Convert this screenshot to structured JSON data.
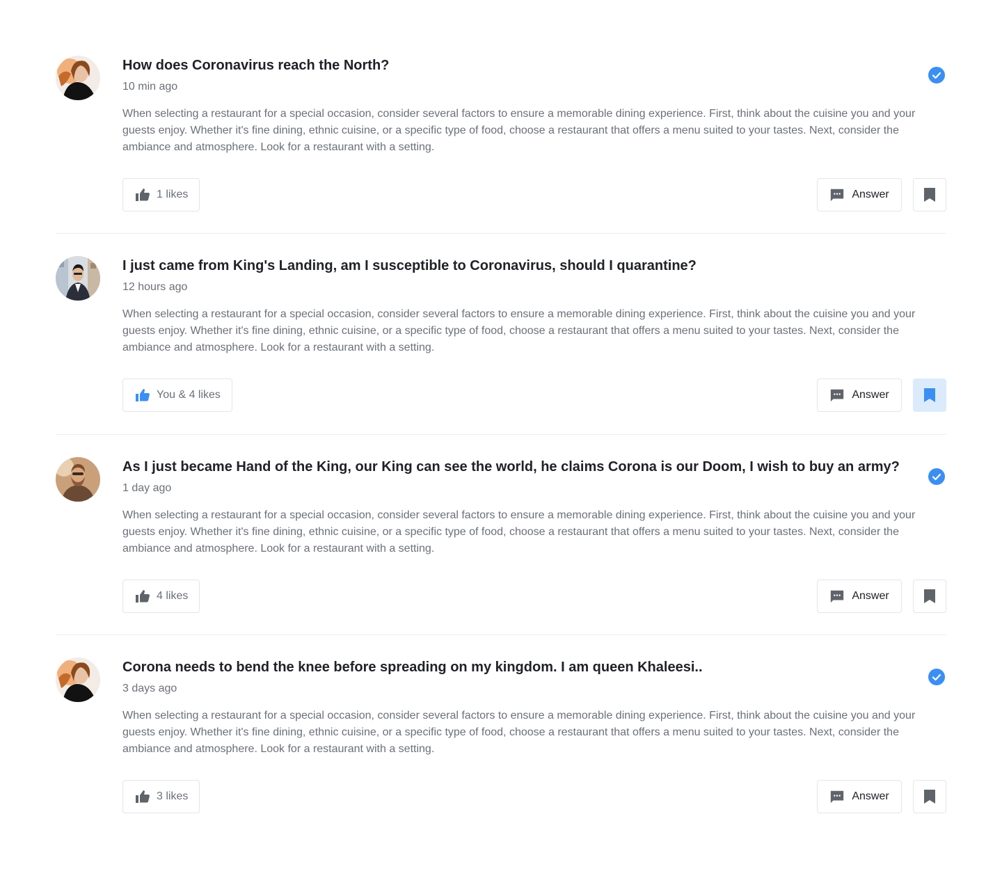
{
  "colors": {
    "accent": "#3b8ff3",
    "icon_gray": "#5f636a",
    "bookmark_active_bg": "#dcebfc"
  },
  "posts": [
    {
      "title": "How does Coronavirus reach the North?",
      "time": "10 min ago",
      "body": "When selecting a restaurant for a special occasion, consider several factors to ensure a memorable dining experience. First, think about the cuisine you and your guests enjoy. Whether it's fine dining, ethnic cuisine, or a specific type of food, choose a restaurant that offers a menu suited to your tastes. Next, consider the ambiance and atmosphere. Look for a restaurant with a setting.",
      "likes_label": "1 likes",
      "liked": false,
      "verified": true,
      "bookmarked": false,
      "answer_label": "Answer",
      "avatar_icon": "avatar-woman-icon"
    },
    {
      "title": "I just came from King's Landing, am I susceptible to Coronavirus, should I quarantine?",
      "time": "12 hours ago",
      "body": "When selecting a restaurant for a special occasion, consider several factors to ensure a memorable dining experience. First, think about the cuisine you and your guests enjoy. Whether it's fine dining, ethnic cuisine, or a specific type of food, choose a restaurant that offers a menu suited to your tastes. Next, consider the ambiance and atmosphere. Look for a restaurant with a setting.",
      "likes_label": "You & 4 likes",
      "liked": true,
      "verified": false,
      "bookmarked": true,
      "answer_label": "Answer",
      "avatar_icon": "avatar-man-suit-icon"
    },
    {
      "title": "As I just became Hand of the King, our King can see the world, he claims Corona is our Doom, I wish to buy an army?",
      "time": "1 day ago",
      "body": "When selecting a restaurant for a special occasion, consider several factors to ensure a memorable dining experience. First, think about the cuisine you and your guests enjoy. Whether it's fine dining, ethnic cuisine, or a specific type of food, choose a restaurant that offers a menu suited to your tastes. Next, consider the ambiance and atmosphere. Look for a restaurant with a setting.",
      "likes_label": "4 likes",
      "liked": false,
      "verified": true,
      "bookmarked": false,
      "answer_label": "Answer",
      "avatar_icon": "avatar-man-beard-icon"
    },
    {
      "title": "Corona needs to bend the knee before spreading on my kingdom. I am queen Khaleesi..",
      "time": "3 days ago",
      "body": "When selecting a restaurant for a special occasion, consider several factors to ensure a memorable dining experience. First, think about the cuisine you and your guests enjoy. Whether it's fine dining, ethnic cuisine, or a specific type of food, choose a restaurant that offers a menu suited to your tastes. Next, consider the ambiance and atmosphere. Look for a restaurant with a setting.",
      "likes_label": "3 likes",
      "liked": false,
      "verified": true,
      "bookmarked": false,
      "answer_label": "Answer",
      "avatar_icon": "avatar-woman-icon"
    }
  ]
}
